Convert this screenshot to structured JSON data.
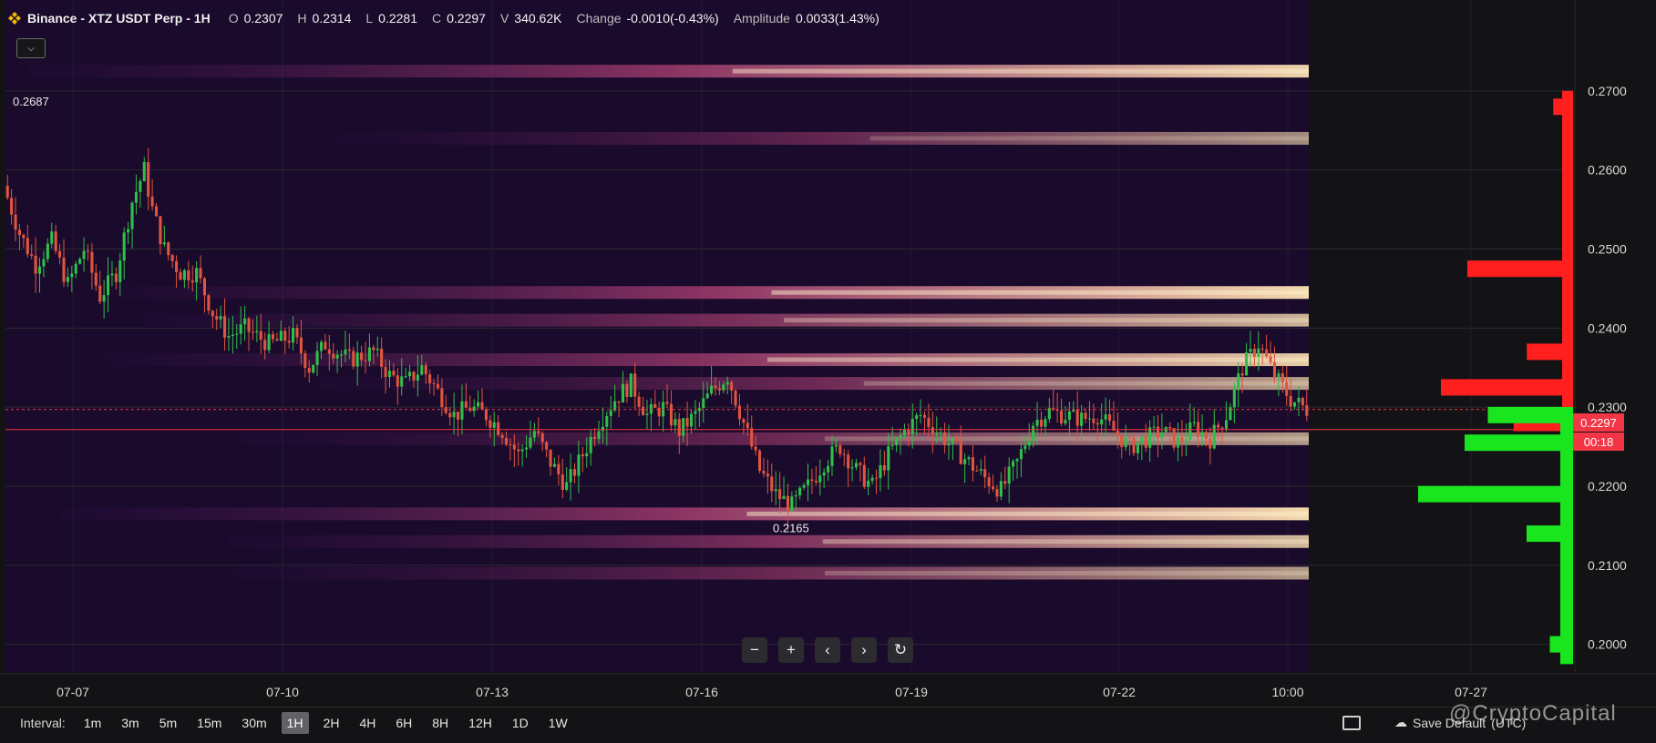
{
  "header": {
    "title": "Binance - XTZ USDT Perp - 1H",
    "ohlc": [
      {
        "label": "O",
        "value": "0.2307"
      },
      {
        "label": "H",
        "value": "0.2314"
      },
      {
        "label": "L",
        "value": "0.2281"
      },
      {
        "label": "C",
        "value": "0.2297"
      },
      {
        "label": "V",
        "value": "340.62K"
      },
      {
        "label": "Change",
        "value": "-0.0010(-0.43%)"
      },
      {
        "label": "Amplitude",
        "value": "0.0033(1.43%)"
      }
    ]
  },
  "price_tag": {
    "price": "0.2297",
    "countdown": "00:18"
  },
  "chart_data": {
    "type": "candlestick",
    "symbol": "XTZ USDT Perp",
    "interval": "1H",
    "y_ticks": [
      "0.2000",
      "0.2100",
      "0.2200",
      "0.2300",
      "0.2400",
      "0.2500",
      "0.2600",
      "0.2700"
    ],
    "x_ticks": [
      "07-07",
      "07-10",
      "07-13",
      "07-16",
      "07-19",
      "07-22",
      "10:00",
      "07-27"
    ],
    "ylim": [
      0.1965,
      0.2815
    ],
    "current_price": 0.2297,
    "annotations": [
      {
        "text": "0.2687",
        "price": 0.2687
      },
      {
        "text": "0.2165",
        "price": 0.2165
      }
    ],
    "price_path": [
      [
        0,
        0.258
      ],
      [
        4,
        0.252
      ],
      [
        8,
        0.248
      ],
      [
        12,
        0.251
      ],
      [
        16,
        0.2455
      ],
      [
        20,
        0.25
      ],
      [
        24,
        0.244
      ],
      [
        28,
        0.247
      ],
      [
        32,
        0.256
      ],
      [
        35,
        0.26
      ],
      [
        37,
        0.255
      ],
      [
        40,
        0.25
      ],
      [
        44,
        0.247
      ],
      [
        48,
        0.247
      ],
      [
        52,
        0.242
      ],
      [
        56,
        0.239
      ],
      [
        60,
        0.24
      ],
      [
        66,
        0.238
      ],
      [
        72,
        0.239
      ],
      [
        76,
        0.235
      ],
      [
        80,
        0.238
      ],
      [
        86,
        0.236
      ],
      [
        92,
        0.237
      ],
      [
        96,
        0.234
      ],
      [
        100,
        0.233
      ],
      [
        104,
        0.235
      ],
      [
        108,
        0.232
      ],
      [
        112,
        0.229
      ],
      [
        116,
        0.23
      ],
      [
        120,
        0.229
      ],
      [
        124,
        0.227
      ],
      [
        128,
        0.224
      ],
      [
        132,
        0.227
      ],
      [
        136,
        0.223
      ],
      [
        140,
        0.22
      ],
      [
        144,
        0.224
      ],
      [
        148,
        0.228
      ],
      [
        152,
        0.231
      ],
      [
        156,
        0.233
      ],
      [
        160,
        0.229
      ],
      [
        164,
        0.23
      ],
      [
        168,
        0.227
      ],
      [
        172,
        0.229
      ],
      [
        176,
        0.232
      ],
      [
        180,
        0.234
      ],
      [
        184,
        0.228
      ],
      [
        188,
        0.222
      ],
      [
        192,
        0.219
      ],
      [
        196,
        0.2175
      ],
      [
        200,
        0.22
      ],
      [
        204,
        0.223
      ],
      [
        208,
        0.225
      ],
      [
        212,
        0.222
      ],
      [
        216,
        0.22
      ],
      [
        220,
        0.224
      ],
      [
        224,
        0.227
      ],
      [
        228,
        0.229
      ],
      [
        232,
        0.227
      ],
      [
        236,
        0.225
      ],
      [
        240,
        0.223
      ],
      [
        244,
        0.221
      ],
      [
        248,
        0.2195
      ],
      [
        252,
        0.223
      ],
      [
        256,
        0.228
      ],
      [
        260,
        0.2295
      ],
      [
        264,
        0.229
      ],
      [
        268,
        0.2285
      ],
      [
        272,
        0.229
      ],
      [
        276,
        0.227
      ],
      [
        280,
        0.225
      ],
      [
        284,
        0.226
      ],
      [
        288,
        0.227
      ],
      [
        292,
        0.2255
      ],
      [
        296,
        0.2275
      ],
      [
        300,
        0.226
      ],
      [
        304,
        0.229
      ],
      [
        308,
        0.235
      ],
      [
        312,
        0.238
      ],
      [
        316,
        0.234
      ],
      [
        320,
        0.231
      ],
      [
        324,
        0.2297
      ]
    ],
    "heatmap_bands": [
      {
        "price": 0.2725,
        "intensity": 0.95
      },
      {
        "price": 0.264,
        "intensity": 0.4
      },
      {
        "price": 0.2445,
        "intensity": 1.0
      },
      {
        "price": 0.241,
        "intensity": 0.7
      },
      {
        "price": 0.236,
        "intensity": 0.9
      },
      {
        "price": 0.233,
        "intensity": 0.55
      },
      {
        "price": 0.226,
        "intensity": 0.5
      },
      {
        "price": 0.2165,
        "intensity": 1.0
      },
      {
        "price": 0.213,
        "intensity": 0.75
      },
      {
        "price": 0.209,
        "intensity": 0.5
      }
    ],
    "volume_profile": {
      "sell": [
        {
          "price": 0.268,
          "size": 0.15
        },
        {
          "price": 0.2475,
          "size": 0.8
        },
        {
          "price": 0.2325,
          "size": 1.0
        },
        {
          "price": 0.237,
          "size": 0.35
        },
        {
          "price": 0.228,
          "size": 0.45
        }
      ],
      "buy": [
        {
          "price": 0.229,
          "size": 0.55
        },
        {
          "price": 0.2255,
          "size": 0.7
        },
        {
          "price": 0.219,
          "size": 1.0
        },
        {
          "price": 0.214,
          "size": 0.3
        },
        {
          "price": 0.2,
          "size": 0.15
        }
      ]
    }
  },
  "navigation": {
    "zoom_out": "−",
    "zoom_in": "+",
    "prev": "‹",
    "next": "›",
    "reset": "↻"
  },
  "bottom": {
    "interval_label": "Interval:",
    "intervals": [
      "1m",
      "3m",
      "5m",
      "15m",
      "30m",
      "1H",
      "2H",
      "4H",
      "6H",
      "8H",
      "12H",
      "1D",
      "1W"
    ],
    "active_interval": "1H",
    "save_label": "Save Default",
    "timestamp": "(UTC)"
  },
  "watermark": "@CryptoCapital",
  "colors": {
    "background": "#131316",
    "up": "#26a69a",
    "down": "#ef5350",
    "buy_profile": "#19e61e",
    "sell_profile": "#ff1f1f",
    "price_line": "#f23645"
  }
}
